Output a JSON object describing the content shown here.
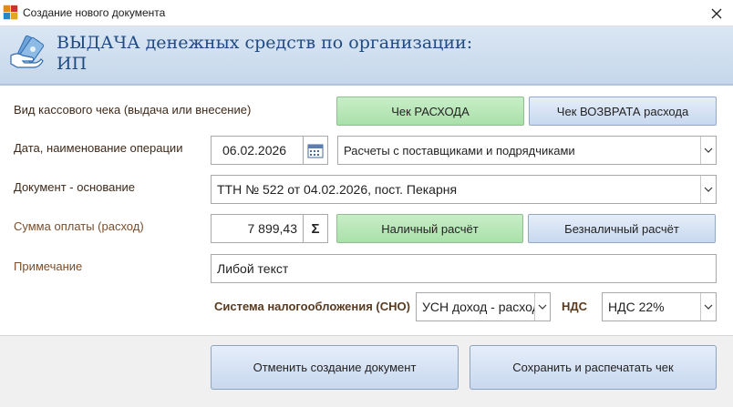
{
  "window": {
    "title": "Создание нового документа",
    "icon": "app-icon"
  },
  "header": {
    "title": "ВЫДАЧА денежных средств по организации:\nИП"
  },
  "form": {
    "receipt_type": {
      "label": "Вид кассового чека (выдача или внесение)",
      "expense_button": "Чек РАСХОДА",
      "return_button": "Чек ВОЗВРАТА расхода"
    },
    "date_operation": {
      "label": "Дата, наименование операции",
      "date": "06.02.2026",
      "operation": "Расчеты с поставщиками и подрядчиками"
    },
    "basis_document": {
      "label": "Документ - основание",
      "value": "ТТН № 522 от 04.02.2026, пост. Пекарня"
    },
    "payment_amount": {
      "label": "Сумма оплаты (расход)",
      "value": "7 899,43",
      "sum_button": "Σ",
      "cash_button": "Наличный расчёт",
      "noncash_button": "Безналичный расчёт"
    },
    "note": {
      "label": "Примечание",
      "value": "Либой текст"
    },
    "tax": {
      "sno_label": "Система налогообложения (СНО)",
      "sno_value": "УСН доход - расход",
      "nds_label": "НДС",
      "nds_value": "НДС 22%"
    }
  },
  "footer": {
    "cancel_button": "Отменить создание документ",
    "save_button": "Сохранить и распечатать чек"
  },
  "colors": {
    "header_bg": "#c6d7eb",
    "header_title": "#1f4a82",
    "green_button": "#a9e0a9",
    "blue_button": "#c8d8ef",
    "label_brown": "#7a4e2b"
  }
}
